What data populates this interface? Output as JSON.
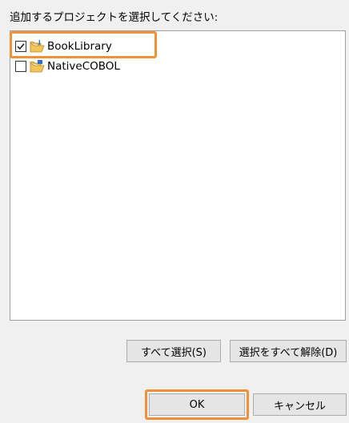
{
  "dialog": {
    "prompt": "追加するプロジェクトを選択してください:"
  },
  "projects": [
    {
      "label": "BookLibrary",
      "checked": true,
      "icon": "java-project-folder-icon"
    },
    {
      "label": "NativeCOBOL",
      "checked": false,
      "icon": "cobol-project-folder-icon"
    }
  ],
  "buttons": {
    "select_all": "すべて選択(S)",
    "deselect_all": "選択をすべて解除(D)",
    "ok": "OK",
    "cancel": "キャンセル"
  },
  "colors": {
    "highlight": "#f0913a",
    "folder": "#e8b84a",
    "accent_blue": "#2a6fd6"
  }
}
